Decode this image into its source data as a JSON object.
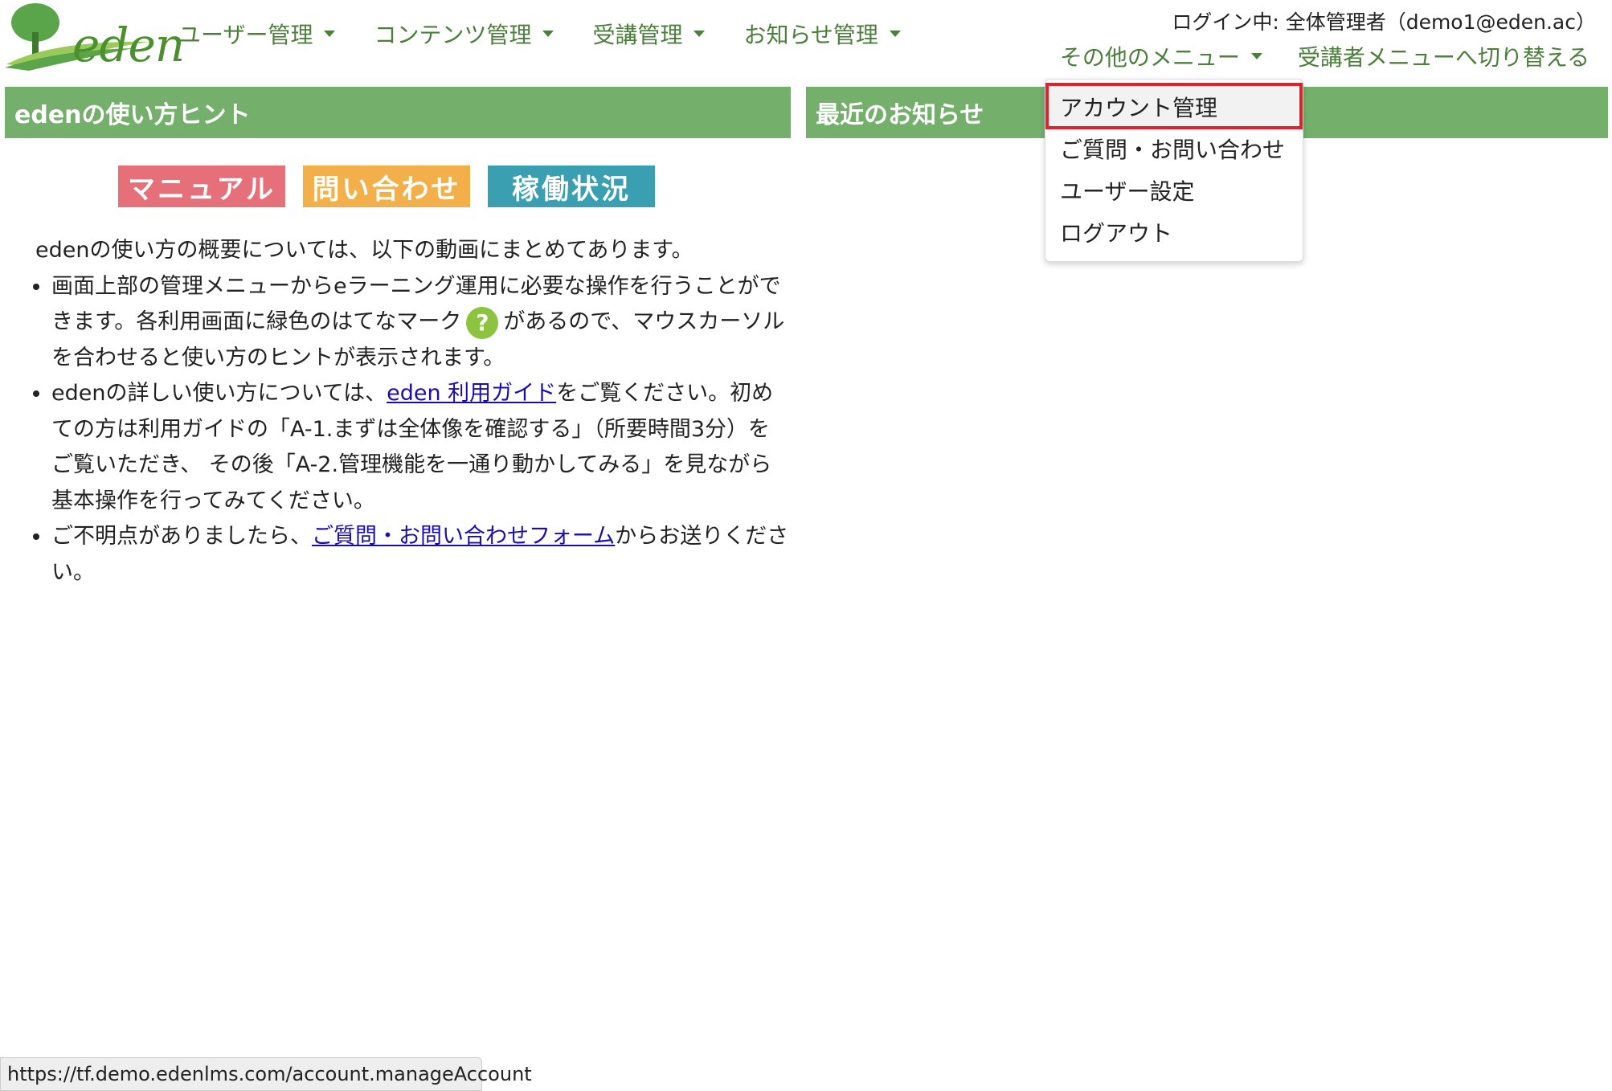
{
  "brand": {
    "logo_text": "eden",
    "accent": "#74b06c",
    "nav_color": "#4b7f3b"
  },
  "header": {
    "login_info": "ログイン中: 全体管理者（demo1@eden.ac）",
    "nav": [
      {
        "label": "ユーザー管理"
      },
      {
        "label": "コンテンツ管理"
      },
      {
        "label": "受講管理"
      },
      {
        "label": "お知らせ管理"
      }
    ],
    "other_menu_label": "その他のメニュー",
    "switch_label": "受講者メニューへ切り替える"
  },
  "dropdown": {
    "items": [
      {
        "label": "アカウント管理",
        "highlighted": true
      },
      {
        "label": "ご質問・お問い合わせ"
      },
      {
        "label": "ユーザー設定"
      },
      {
        "label": "ログアウト"
      }
    ]
  },
  "left_panel": {
    "title": "edenの使い方ヒント",
    "buttons": [
      {
        "label": "マニュアル",
        "color": "#e5707a"
      },
      {
        "label": "問い合わせ",
        "color": "#f3b04a"
      },
      {
        "label": "稼働状況",
        "color": "#3a9fb0"
      }
    ],
    "intro": "edenの使い方の概要については、以下の動画にまとめてあります。",
    "bullet1_a": "画面上部の管理メニューからeラーニング運用に必要な操作を行うことができます。各利用画面に緑色のはてなマーク",
    "help_icon": "?",
    "bullet1_b": "があるので、マウスカーソルを合わせると使い方のヒントが表示されます。",
    "bullet2_a": "edenの詳しい使い方については、",
    "bullet2_link": "eden 利用ガイド",
    "bullet2_b": "をご覧ください。初めての方は利用ガイドの「A-1.まずは全体像を確認する」（所要時間3分）をご覧いただき、 その後「A-2.管理機能を一通り動かしてみる」を見ながら基本操作を行ってみてください。",
    "bullet3_a": "ご不明点がありましたら、",
    "bullet3_link": "ご質問・お問い合わせフォーム",
    "bullet3_b": "からお送りください。"
  },
  "right_panel": {
    "title": "最近のお知らせ"
  },
  "status_bar": {
    "url": "https://tf.demo.edenlms.com/account.manageAccount"
  }
}
